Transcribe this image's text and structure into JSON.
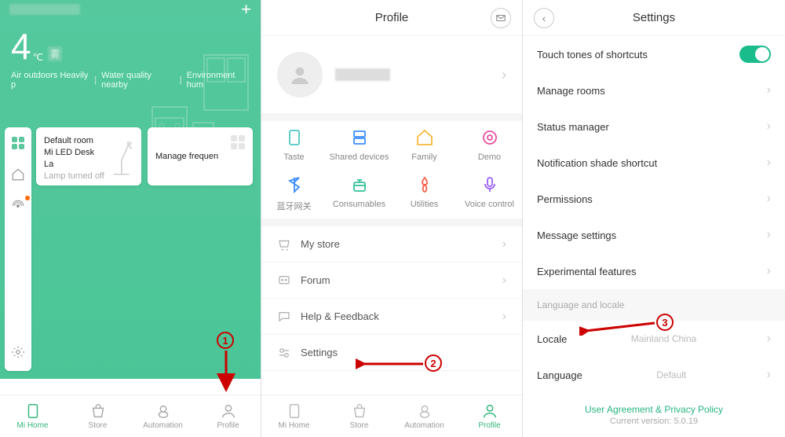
{
  "phone1": {
    "temperature": "4",
    "unit": "℃",
    "condition": "雾",
    "info": [
      "Air outdoors Heavily p",
      "Water quality nearby ",
      "Environment hum"
    ],
    "card1": {
      "room": "Default room",
      "device": "Mi LED Desk La",
      "status": "Lamp turned off"
    },
    "card2": {
      "label": "Manage frequen"
    },
    "nav": [
      "Mi Home",
      "Store",
      "Automation",
      "Profile"
    ]
  },
  "phone2": {
    "title": "Profile",
    "grid": [
      "Taste",
      "Shared devices",
      "Family",
      "Demo",
      "蓝牙网关",
      "Consumables",
      "Utilities",
      "Voice control"
    ],
    "list": [
      "My store",
      "Forum",
      "Help & Feedback",
      "Settings"
    ],
    "nav": [
      "Mi Home",
      "Store",
      "Automation",
      "Profile"
    ]
  },
  "phone3": {
    "title": "Settings",
    "rows": {
      "touch": "Touch tones of shortcuts",
      "rooms": "Manage rooms",
      "status": "Status manager",
      "shade": "Notification shade shortcut",
      "perm": "Permissions",
      "msg": "Message settings",
      "exp": "Experimental features",
      "section": "Language and locale",
      "locale": "Locale",
      "locale_val": "Mainland China",
      "lang": "Language",
      "lang_val": "Default"
    },
    "footer_link": "User Agreement & Privacy Policy",
    "footer_ver": "Current version: 5.0.19"
  },
  "annotations": {
    "1": "1",
    "2": "2",
    "3": "3"
  }
}
